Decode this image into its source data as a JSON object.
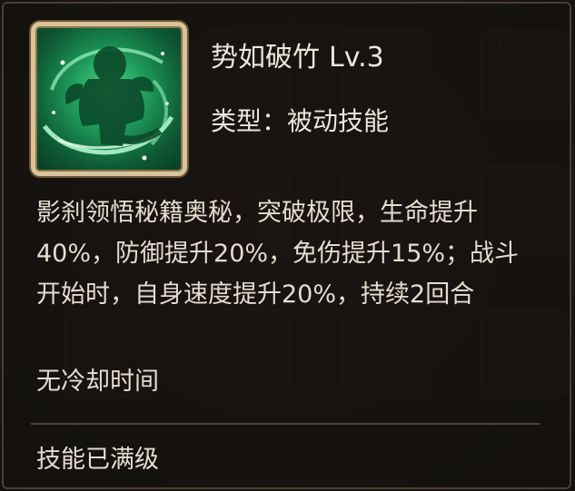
{
  "tooltip": {
    "skill_name": "势如破竹",
    "level": "Lv.3",
    "type_line": "类型：被动技能",
    "description": "影刹领悟秘籍奥秘，突破极限，生命提升40%，防御提升20%，免伤提升15%；战斗开始时，自身速度提升20%，持续2回合",
    "cooldown": "无冷却时间",
    "status": "技能已满级",
    "icon": "green-whirlwind-warrior-skill-icon"
  },
  "background": {
    "badge": "3"
  },
  "colors": {
    "frame_gold": "#d8c39a",
    "icon_green": "#1e9a5a",
    "text": "#e4dccf",
    "panel_bg": "#14110f"
  }
}
